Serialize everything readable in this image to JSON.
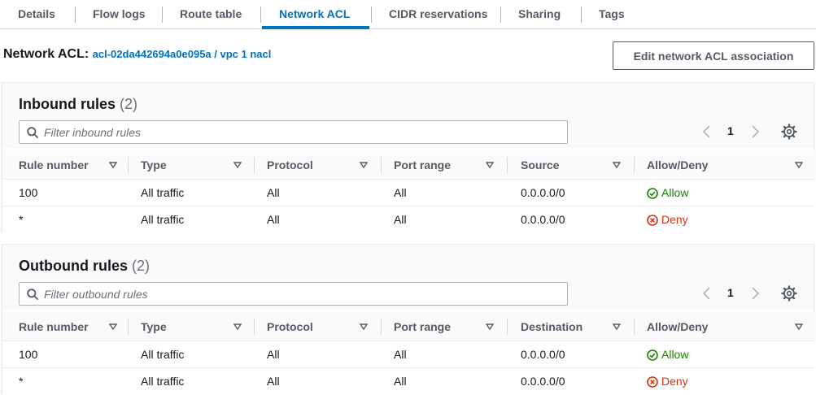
{
  "tabs": [
    "Details",
    "Flow logs",
    "Route table",
    "Network ACL",
    "CIDR reservations",
    "Sharing",
    "Tags"
  ],
  "acl": {
    "label": "Network ACL:",
    "link": "acl-02da442694a0e095a / vpc 1 nacl",
    "edit_button": "Edit network ACL association"
  },
  "inbound": {
    "title": "Inbound rules",
    "count": "(2)",
    "filter_placeholder": "Filter inbound rules",
    "page": "1",
    "columns": [
      "Rule number",
      "Type",
      "Protocol",
      "Port range",
      "Source",
      "Allow/Deny"
    ],
    "rows": [
      {
        "rule": "100",
        "type": "All traffic",
        "protocol": "All",
        "port": "All",
        "addr": "0.0.0.0/0",
        "action": "Allow"
      },
      {
        "rule": "*",
        "type": "All traffic",
        "protocol": "All",
        "port": "All",
        "addr": "0.0.0.0/0",
        "action": "Deny"
      }
    ]
  },
  "outbound": {
    "title": "Outbound rules",
    "count": "(2)",
    "filter_placeholder": "Filter outbound rules",
    "page": "1",
    "columns": [
      "Rule number",
      "Type",
      "Protocol",
      "Port range",
      "Destination",
      "Allow/Deny"
    ],
    "rows": [
      {
        "rule": "100",
        "type": "All traffic",
        "protocol": "All",
        "port": "All",
        "addr": "0.0.0.0/0",
        "action": "Allow"
      },
      {
        "rule": "*",
        "type": "All traffic",
        "protocol": "All",
        "port": "All",
        "addr": "0.0.0.0/0",
        "action": "Deny"
      }
    ]
  },
  "icons": {
    "search": "search-icon",
    "prev": "chevron-left-icon",
    "next": "chevron-right-icon",
    "settings": "gear-icon",
    "sort": "sort-down-icon",
    "allow": "check-circle-icon",
    "deny": "x-circle-icon"
  },
  "colors": {
    "link": "#0073bb",
    "allow": "#1d8102",
    "deny": "#d13212",
    "active_tab": "#0073bb"
  }
}
